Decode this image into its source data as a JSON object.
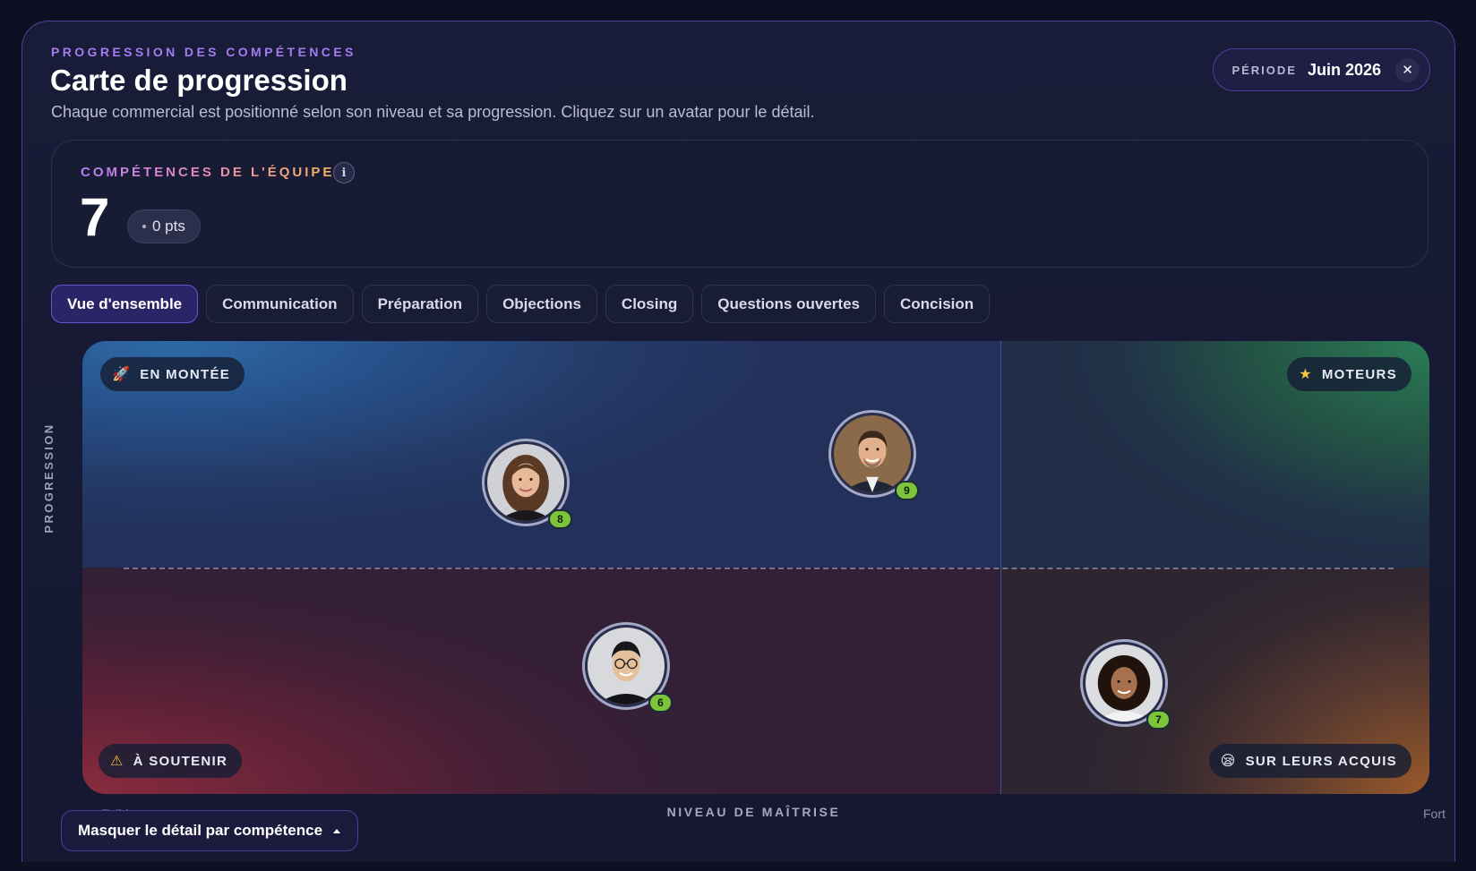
{
  "header": {
    "eyebrow": "PROGRESSION DES COMPÉTENCES",
    "title": "Carte de progression",
    "subtitle": "Chaque commercial est positionné selon son niveau et sa progression. Cliquez sur un avatar pour le détail."
  },
  "period": {
    "label": "PÉRIODE",
    "value": "Juin 2026",
    "close_icon": "close-icon"
  },
  "team_score": {
    "label": "COMPÉTENCES DE L'ÉQUIPE",
    "value": "7",
    "delta": "0 pts",
    "info_icon": "info-icon"
  },
  "tabs": [
    {
      "label": "Vue d'ensemble",
      "active": true
    },
    {
      "label": "Communication",
      "active": false
    },
    {
      "label": "Préparation",
      "active": false
    },
    {
      "label": "Objections",
      "active": false
    },
    {
      "label": "Closing",
      "active": false
    },
    {
      "label": "Questions ouvertes",
      "active": false
    },
    {
      "label": "Concision",
      "active": false
    }
  ],
  "quadrants": {
    "top_left": {
      "label": "EN MONTÉE",
      "icon": "rocket-icon"
    },
    "top_right": {
      "label": "MOTEURS",
      "icon": "star-icon"
    },
    "bottom_left": {
      "label": "À SOUTENIR",
      "icon": "warning-icon"
    },
    "bottom_right": {
      "label": "SUR LEURS ACQUIS",
      "icon": "sleepy-face-icon"
    }
  },
  "reps": [
    {
      "score": "8",
      "quadrant": "top_left",
      "accent": "#7cc43a"
    },
    {
      "score": "9",
      "quadrant": "top_left",
      "accent": "#7cc43a"
    },
    {
      "score": "6",
      "quadrant": "bottom_left",
      "accent": "#7cc43a"
    },
    {
      "score": "7",
      "quadrant": "bottom_right",
      "accent": "#7cc43a"
    }
  ],
  "axes": {
    "y_label": "PROGRESSION",
    "x_label": "NIVEAU DE MAÎTRISE",
    "x_min": "Faible",
    "x_max": "Fort"
  },
  "toggle": {
    "label": "Masquer le détail par compétence",
    "icon": "caret-up-icon"
  },
  "colors": {
    "accent": "#6a52d6",
    "badge": "#7cc43a",
    "eyebrow": "#a47cf0"
  }
}
